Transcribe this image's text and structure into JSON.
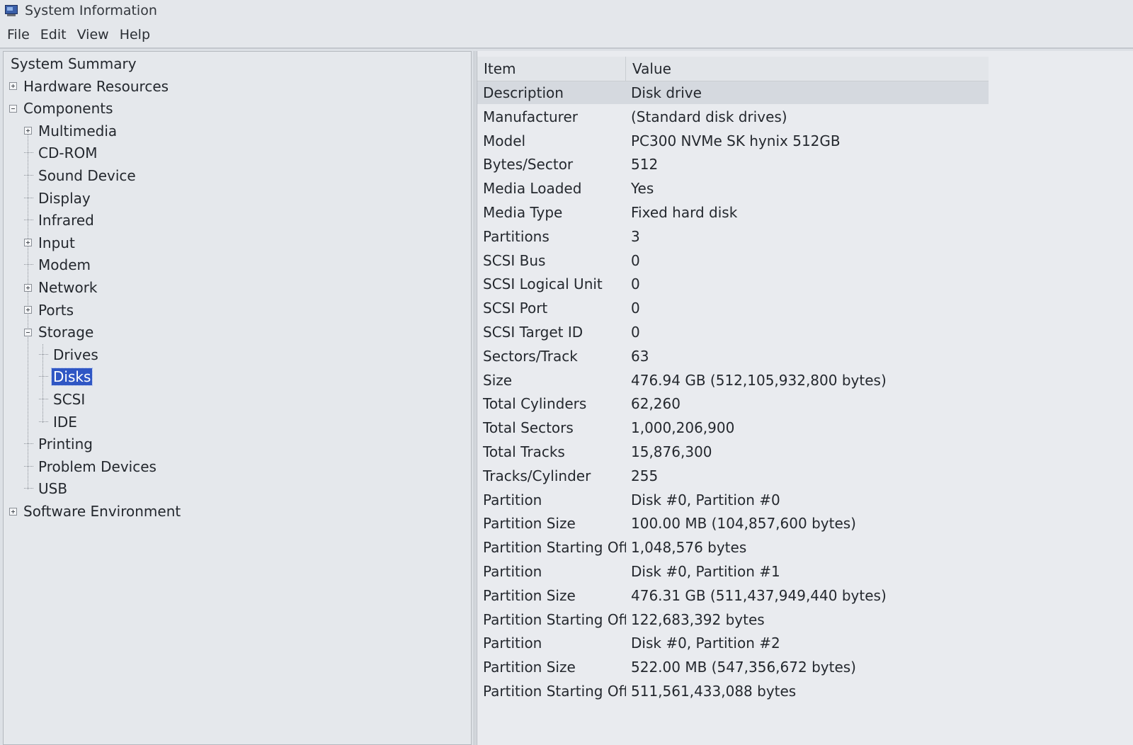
{
  "window": {
    "title": "System Information"
  },
  "menu": [
    "File",
    "Edit",
    "View",
    "Help"
  ],
  "tree": [
    {
      "label": "System Summary",
      "level": 0,
      "toggle": "none"
    },
    {
      "label": "Hardware Resources",
      "level": 0,
      "toggle": "plus"
    },
    {
      "label": "Components",
      "level": 0,
      "toggle": "minus"
    },
    {
      "label": "Multimedia",
      "level": 1,
      "toggle": "plus"
    },
    {
      "label": "CD-ROM",
      "level": 1,
      "toggle": "leaf"
    },
    {
      "label": "Sound Device",
      "level": 1,
      "toggle": "leaf"
    },
    {
      "label": "Display",
      "level": 1,
      "toggle": "leaf"
    },
    {
      "label": "Infrared",
      "level": 1,
      "toggle": "leaf"
    },
    {
      "label": "Input",
      "level": 1,
      "toggle": "plus"
    },
    {
      "label": "Modem",
      "level": 1,
      "toggle": "leaf"
    },
    {
      "label": "Network",
      "level": 1,
      "toggle": "plus"
    },
    {
      "label": "Ports",
      "level": 1,
      "toggle": "plus"
    },
    {
      "label": "Storage",
      "level": 1,
      "toggle": "minus"
    },
    {
      "label": "Drives",
      "level": 2,
      "toggle": "leaf"
    },
    {
      "label": "Disks",
      "level": 2,
      "toggle": "leaf",
      "selected": true
    },
    {
      "label": "SCSI",
      "level": 2,
      "toggle": "leaf"
    },
    {
      "label": "IDE",
      "level": 2,
      "toggle": "leaf"
    },
    {
      "label": "Printing",
      "level": 1,
      "toggle": "leaf"
    },
    {
      "label": "Problem Devices",
      "level": 1,
      "toggle": "leaf"
    },
    {
      "label": "USB",
      "level": 1,
      "toggle": "leaf"
    },
    {
      "label": "Software Environment",
      "level": 0,
      "toggle": "plus"
    }
  ],
  "list": {
    "columns": [
      "Item",
      "Value"
    ],
    "rows": [
      [
        "Description",
        "Disk drive"
      ],
      [
        "Manufacturer",
        "(Standard disk drives)"
      ],
      [
        "Model",
        "PC300 NVMe SK hynix 512GB"
      ],
      [
        "Bytes/Sector",
        "512"
      ],
      [
        "Media Loaded",
        "Yes"
      ],
      [
        "Media Type",
        "Fixed hard disk"
      ],
      [
        "Partitions",
        "3"
      ],
      [
        "SCSI Bus",
        "0"
      ],
      [
        "SCSI Logical Unit",
        "0"
      ],
      [
        "SCSI Port",
        "0"
      ],
      [
        "SCSI Target ID",
        "0"
      ],
      [
        "Sectors/Track",
        "63"
      ],
      [
        "Size",
        "476.94 GB (512,105,932,800 bytes)"
      ],
      [
        "Total Cylinders",
        "62,260"
      ],
      [
        "Total Sectors",
        "1,000,206,900"
      ],
      [
        "Total Tracks",
        "15,876,300"
      ],
      [
        "Tracks/Cylinder",
        "255"
      ],
      [
        "Partition",
        "Disk #0, Partition #0"
      ],
      [
        "Partition Size",
        "100.00 MB (104,857,600 bytes)"
      ],
      [
        "Partition Starting Off...",
        "1,048,576 bytes"
      ],
      [
        "Partition",
        "Disk #0, Partition #1"
      ],
      [
        "Partition Size",
        "476.31 GB (511,437,949,440 bytes)"
      ],
      [
        "Partition Starting Off...",
        "122,683,392 bytes"
      ],
      [
        "Partition",
        "Disk #0, Partition #2"
      ],
      [
        "Partition Size",
        "522.00 MB (547,356,672 bytes)"
      ],
      [
        "Partition Starting Off...",
        "511,561,433,088 bytes"
      ]
    ],
    "selected_row": 0
  }
}
